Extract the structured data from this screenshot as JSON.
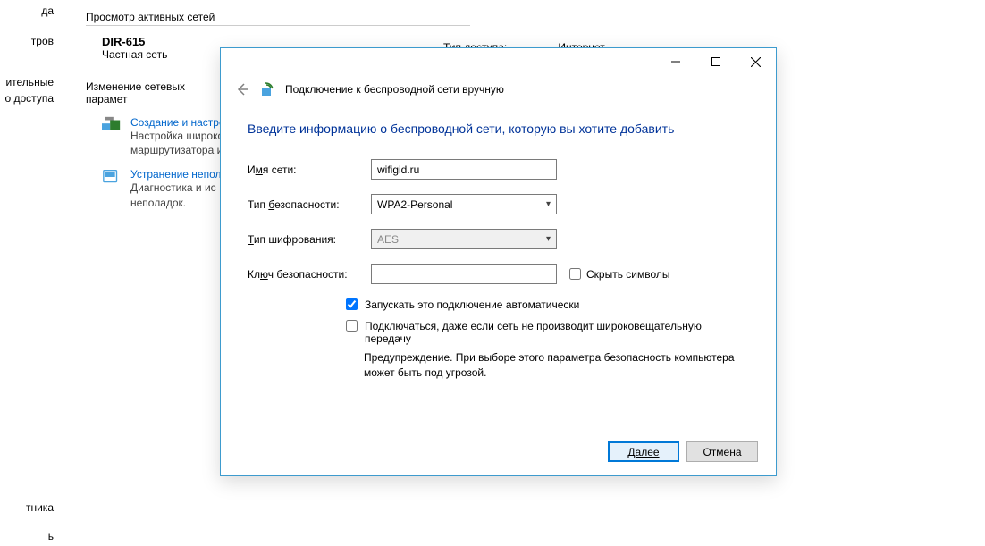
{
  "bg": {
    "left_frags": [
      "да",
      "тров",
      "ительные",
      "о доступа"
    ],
    "active_networks": "Просмотр активных сетей",
    "net_name": "DIR-615",
    "net_type": "Частная сеть",
    "access_label": "Тип доступа:",
    "access_value": "Интернет",
    "change_params": "Изменение сетевых парамет",
    "link1_title": "Создание и настро",
    "link1_desc1": "Настройка широко",
    "link1_desc2": "маршрутизатора и",
    "link2_title": "Устранение непол",
    "link2_desc1": "Диагностика и ис",
    "link2_desc2": "неполадок.",
    "bottom_frag1": "тника",
    "bottom_frag2": "ь"
  },
  "dlg": {
    "title": "Подключение к беспроводной сети вручную",
    "headline": "Введите информацию о беспроводной сети, которую вы хотите добавить",
    "name_label_pre": "И",
    "name_label_u": "м",
    "name_label_post": "я сети:",
    "name_value": "wifigid.ru",
    "sec_label_pre": "Тип ",
    "sec_label_u": "б",
    "sec_label_post": "езопасности:",
    "sec_value": "WPA2-Personal",
    "enc_label_pre": "",
    "enc_label_u": "Т",
    "enc_label_post": "ип шифрования:",
    "enc_value": "AES",
    "key_label_pre": "Кл",
    "key_label_u": "ю",
    "key_label_post": "ч безопасности:",
    "key_value": "",
    "hide_label_pre": "Скр",
    "hide_label_u": "ы",
    "hide_label_post": "ть символы",
    "auto_label_pre": "",
    "auto_label_u": "З",
    "auto_label_post": "апускать это подключение автоматически",
    "broadcast_label_pre": "",
    "broadcast_label_u": "П",
    "broadcast_label_post": "одключаться, даже если сеть не производит широковещательную передачу",
    "broadcast_warn": "Предупреждение. При выборе этого параметра безопасность компьютера может быть под угрозой.",
    "next": "Далее",
    "cancel": "Отмена"
  }
}
